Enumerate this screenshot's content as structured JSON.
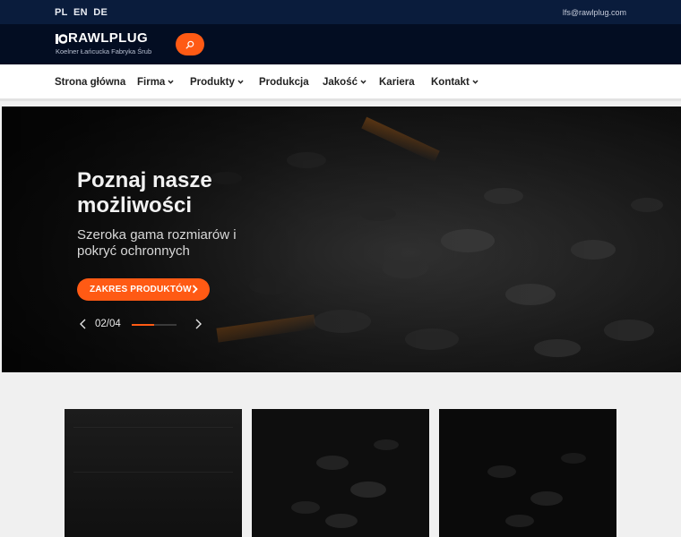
{
  "topbar": {
    "languages": [
      "PL",
      "EN",
      "DE"
    ],
    "email": "lfs@rawlplug.com"
  },
  "brand": {
    "name": "RAWLPLUG",
    "subtitle": "Koelner Łańcucka Fabryka Śrub"
  },
  "nav": {
    "items": [
      {
        "label": "Strona główna",
        "dropdown": false
      },
      {
        "label": "Firma",
        "dropdown": true
      },
      {
        "label": "Produkty",
        "dropdown": true
      },
      {
        "label": "Produkcja",
        "dropdown": false
      },
      {
        "label": "Jakość",
        "dropdown": true
      },
      {
        "label": "Kariera",
        "dropdown": false
      },
      {
        "label": "Kontakt",
        "dropdown": true
      }
    ]
  },
  "hero": {
    "title": "Poznaj nasze możliwości",
    "subtitle": "Szeroka gama rozmiarów i pokryć ochronnych",
    "cta_label": "ZAKRES PRODUKTÓW",
    "counter": "02/04",
    "slide_progress": 0.5
  },
  "cards": [
    {
      "image": "dark-metal-texture"
    },
    {
      "image": "screws-pile"
    },
    {
      "image": "screws-pile-dark"
    }
  ],
  "colors": {
    "accent": "#ff5a14",
    "topbar": "#0a1c3c",
    "brandbar": "#030d22"
  }
}
